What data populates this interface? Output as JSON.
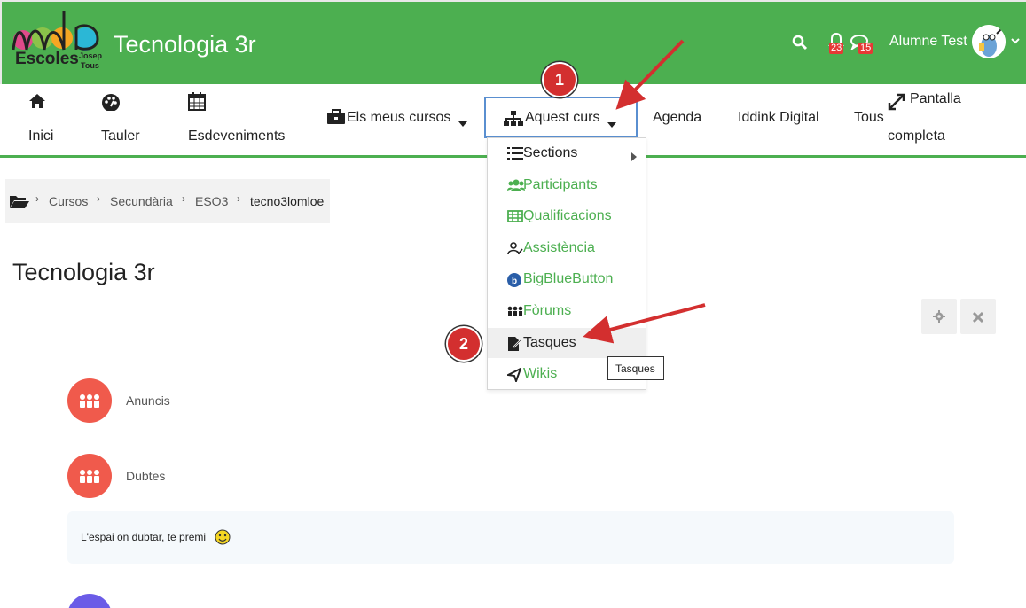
{
  "header": {
    "logo_text_main": "Escoles",
    "logo_text_josep": "Josep",
    "logo_text_tous": "Tous",
    "site_title": "Tecnologia 3r",
    "search_icon": "search-icon",
    "notifications_count": "23",
    "messages_count": "15",
    "user_name": "Alumne Test"
  },
  "nav": {
    "items": [
      {
        "label": "Inici",
        "icon": "home-icon"
      },
      {
        "label": "Tauler",
        "icon": "dashboard-icon"
      },
      {
        "label": "Esdeveniments",
        "icon": "calendar-icon"
      },
      {
        "label": "Els meus cursos",
        "icon": "briefcase-icon"
      },
      {
        "label": "Aquest curs",
        "icon": "sitemap-icon"
      },
      {
        "label": "Agenda"
      },
      {
        "label": "Iddink Digital"
      },
      {
        "label": "Tous"
      }
    ],
    "fullscreen_line1": "Pantalla",
    "fullscreen_line2": "completa"
  },
  "dropdown": {
    "items": [
      {
        "label": "Sections",
        "icon": "list-icon"
      },
      {
        "label": "Participants",
        "icon": "users-icon"
      },
      {
        "label": "Qualificacions",
        "icon": "table-icon"
      },
      {
        "label": "Assistència",
        "icon": "attendance-icon"
      },
      {
        "label": "BigBlueButton",
        "icon": "bigbluebutton-icon"
      },
      {
        "label": "Fòrums",
        "icon": "forum-icon"
      },
      {
        "label": "Tasques",
        "icon": "assignment-icon"
      },
      {
        "label": "Wikis",
        "icon": "wiki-icon"
      }
    ],
    "tooltip": "Tasques"
  },
  "breadcrumb": {
    "items": [
      "Cursos",
      "Secundària",
      "ESO3",
      "tecno3lomloe"
    ]
  },
  "page_title": "Tecnologia 3r",
  "activities": [
    {
      "label": "Anuncis"
    },
    {
      "label": "Dubtes",
      "description": "L'espai on dubtar, te premi"
    }
  ],
  "annotations": {
    "marker1": "1",
    "marker2": "2"
  },
  "colors": {
    "brand_green": "#4caf50",
    "activity_coral": "#f05a4c",
    "marker_red": "#d32f2f"
  }
}
